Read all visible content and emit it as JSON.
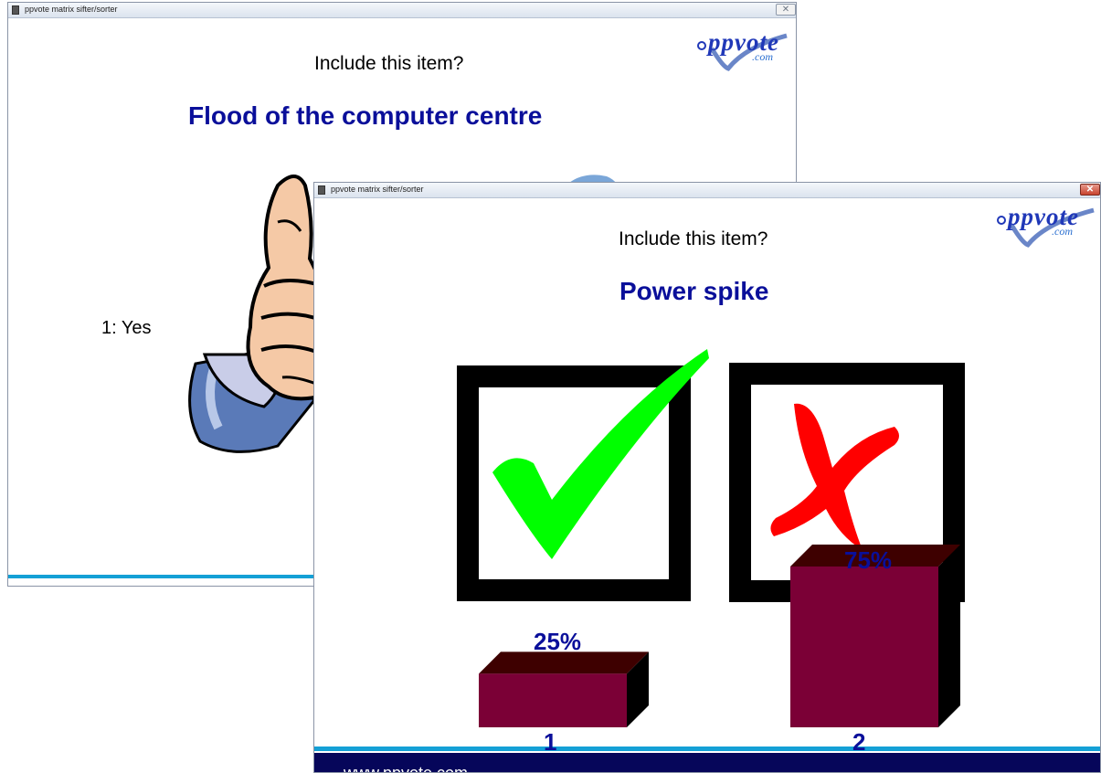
{
  "back_window": {
    "title": "ppvote matrix sifter/sorter",
    "question": "Include this item?",
    "item": "Flood of the computer centre",
    "option_label": "1: Yes",
    "close_icon": "close-icon",
    "logo": {
      "name": "ppvote",
      "suffix": ".com"
    }
  },
  "front_window": {
    "title": "ppvote matrix sifter/sorter",
    "question": "Include this item?",
    "item": "Power spike",
    "close_icon": "close-icon",
    "logo": {
      "name": "ppvote",
      "suffix": ".com"
    },
    "footer_url": "www.ppvote.com",
    "colors": {
      "check": "#00ff00",
      "cross": "#ff0000",
      "bar_front": "#7b0036",
      "bar_top": "#3e0000",
      "bar_side": "#000000",
      "title": "#0a0f9a",
      "footer": "#06065a",
      "line": "#14a0d6"
    }
  },
  "chart_data": {
    "type": "bar",
    "categories": [
      "1",
      "2"
    ],
    "values": [
      25,
      75
    ],
    "value_labels": [
      "25%",
      "75%"
    ],
    "title": "",
    "ylim": [
      0,
      100
    ],
    "icons": [
      "checkmark-icon",
      "cross-icon"
    ]
  }
}
